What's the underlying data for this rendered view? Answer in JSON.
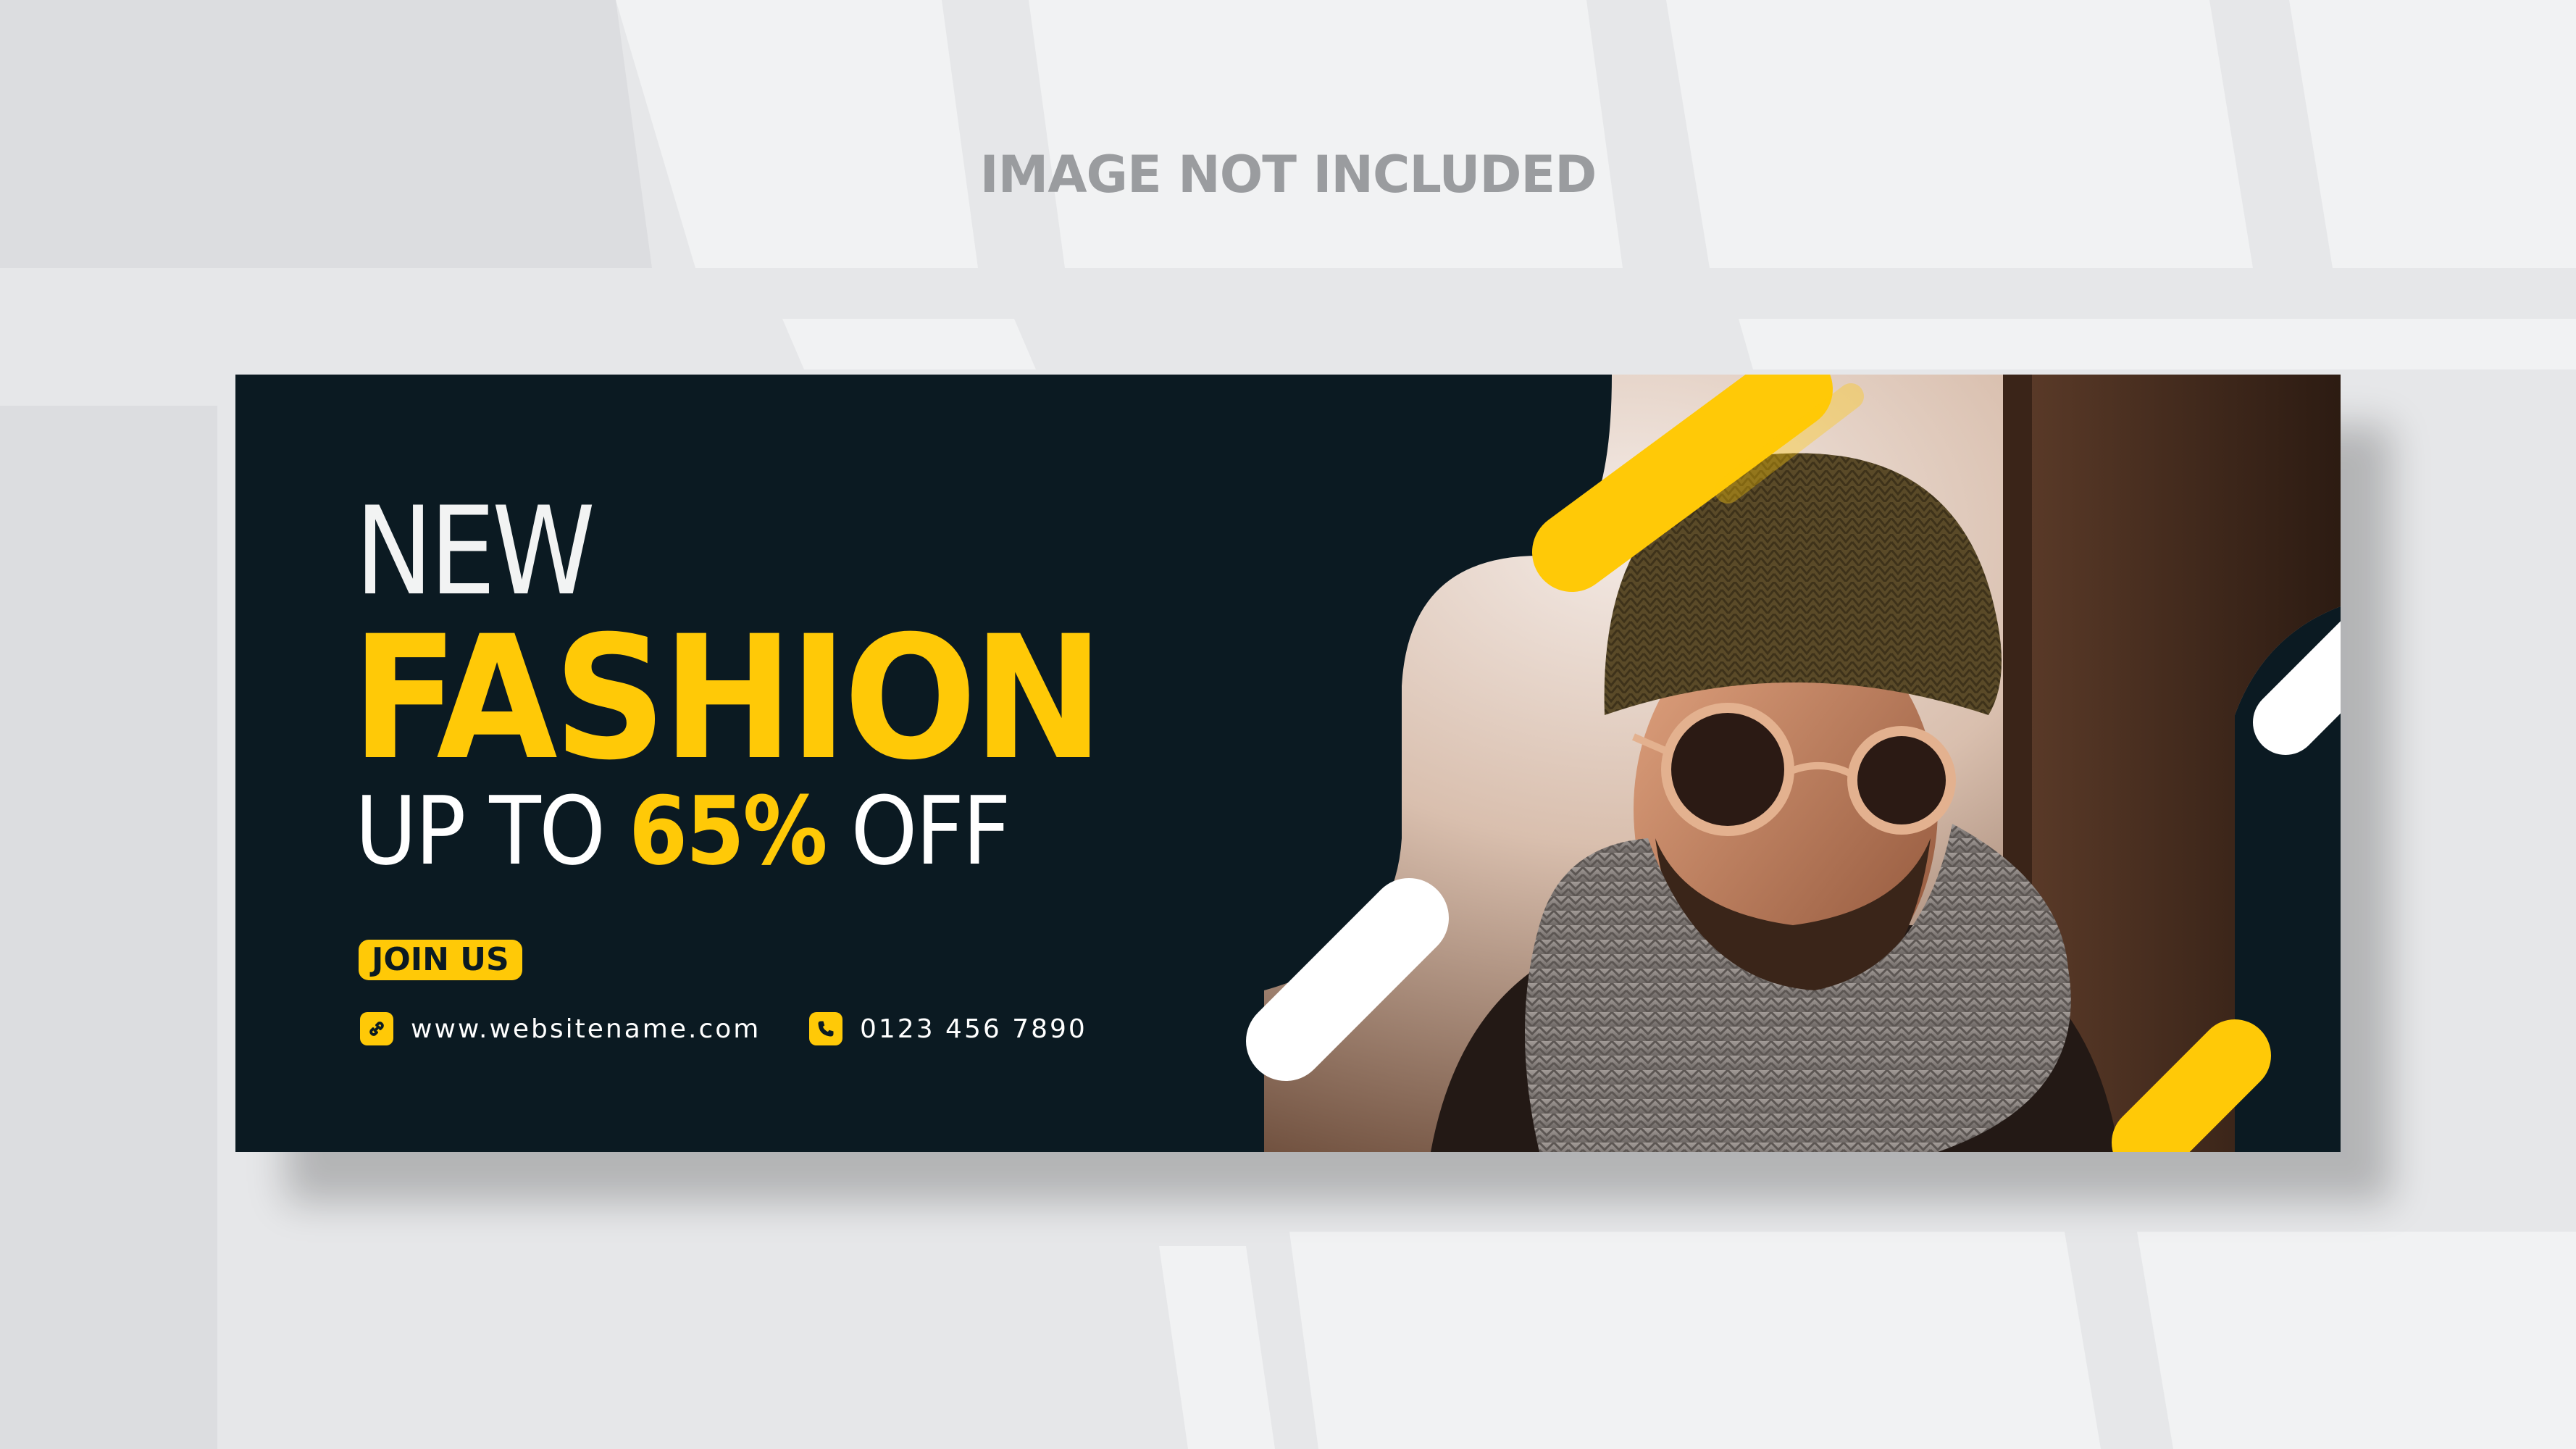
{
  "notice": "IMAGE NOT INCLUDED",
  "banner": {
    "headline_new": "NEW",
    "headline_fashion": "FASHION",
    "offer_prefix": "UP TO",
    "offer_value": "65%",
    "offer_suffix": "OFF",
    "join_label": "JOIN US",
    "website": "www.websitename.com",
    "phone": "0123 456 7890"
  },
  "icons": {
    "website": "link-icon",
    "phone": "phone-icon"
  },
  "colors": {
    "background": "#e6e7e9",
    "banner": "#0b1a22",
    "accent": "#ffc907",
    "text": "#ffffff",
    "notice_text": "#9a9c9f"
  }
}
